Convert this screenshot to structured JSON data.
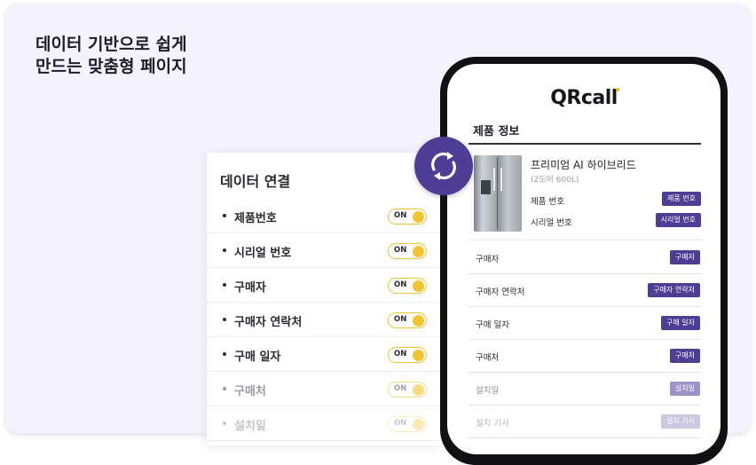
{
  "headline": {
    "line1": "데이터 기반으로 쉽게",
    "line2": "만드는 맞춤형 페이지"
  },
  "panel": {
    "title": "데이터 연결",
    "items": [
      {
        "label": "제품번호",
        "toggle": "ON"
      },
      {
        "label": "시리얼 번호",
        "toggle": "ON"
      },
      {
        "label": "구매자",
        "toggle": "ON"
      },
      {
        "label": "구매자 연락처",
        "toggle": "ON"
      },
      {
        "label": "구매 일자",
        "toggle": "ON"
      },
      {
        "label": "구매처",
        "toggle": "ON"
      },
      {
        "label": "설치일",
        "toggle": "ON"
      }
    ]
  },
  "sync_icon": "sync-arrows-icon",
  "phone": {
    "logo": "QRcall",
    "section_title": "제품 정보",
    "product": {
      "name": "프리미엄 AI 하이브리드",
      "subtitle": "(2도어 600L)",
      "fields": [
        {
          "label": "제품 번호",
          "tag": "제품 번호"
        },
        {
          "label": "시리얼 번호",
          "tag": "시리얼 번호"
        }
      ]
    },
    "fields": [
      {
        "label": "구매자",
        "tag": "구매자"
      },
      {
        "label": "구매자 연락처",
        "tag": "구매자 연락처"
      },
      {
        "label": "구매 일자",
        "tag": "구매 일자"
      },
      {
        "label": "구매처",
        "tag": "구매처"
      },
      {
        "label": "설치일",
        "tag": "설치일"
      },
      {
        "label": "설치 기사",
        "tag": "설치 기사"
      }
    ]
  },
  "colors": {
    "accent": "#4e3d94",
    "toggle": "#f4c430",
    "background": "#f4f3fd"
  }
}
